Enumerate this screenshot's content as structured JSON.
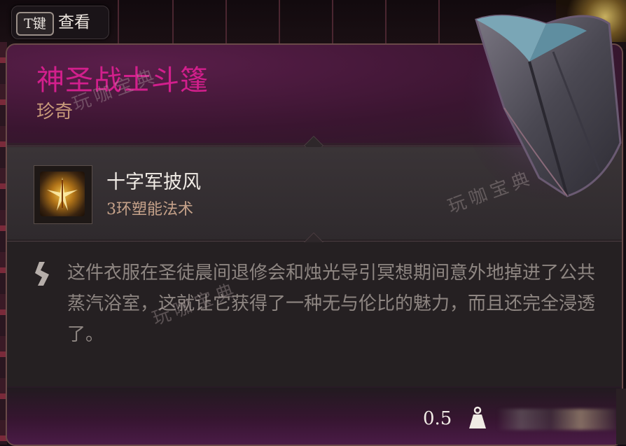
{
  "key_hint": {
    "key": "T键",
    "label": "查看"
  },
  "item": {
    "name": "神圣战士斗篷",
    "rarity": "珍奇",
    "rarity_color": "#c89a7a",
    "name_color": "#d21f8c",
    "icon": "cloak-icon"
  },
  "spell": {
    "name": "十字军披风",
    "level": "3环塑能法术",
    "icon": "crusaders-mantle-icon"
  },
  "description": "这件衣服在圣徒晨间退修会和烛光导引冥想期间意外地掉进了公共蒸汽浴室，这就让它获得了一种无与伦比的魅力，而且还完全浸透了。",
  "footer": {
    "weight": "0.5",
    "weight_icon": "weight-icon"
  },
  "watermark": "玩咖宝典"
}
